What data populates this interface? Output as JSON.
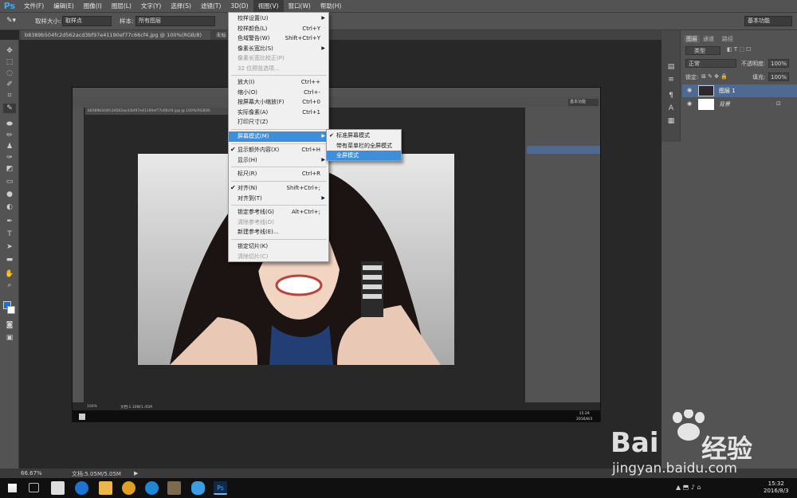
{
  "app": {
    "logo": "Ps"
  },
  "menubar": [
    {
      "label": "文件(F)"
    },
    {
      "label": "编辑(E)"
    },
    {
      "label": "图像(I)"
    },
    {
      "label": "图层(L)"
    },
    {
      "label": "文字(Y)"
    },
    {
      "label": "选择(S)"
    },
    {
      "label": "滤镜(T)"
    },
    {
      "label": "3D(D)"
    },
    {
      "label": "视图(V)"
    },
    {
      "label": "窗口(W)"
    },
    {
      "label": "帮助(H)"
    }
  ],
  "options": {
    "sample_size_label": "取样大小:",
    "sample_size_value": "取样点",
    "sample_label": "样本:",
    "sample_value": "所有图层",
    "workspace": "基本功能"
  },
  "tabs": [
    {
      "label": "b8389b504fc2d562acd3bf97e41190ef77c66cf4.jpg @ 100%(RGB/8)"
    },
    {
      "label": "未标"
    }
  ],
  "view_menu": [
    {
      "label": "校样设置(U)",
      "shortcut": "",
      "submenu": true,
      "disabled": false
    },
    {
      "label": "校样颜色(L)",
      "shortcut": "Ctrl+Y",
      "submenu": false,
      "disabled": false
    },
    {
      "label": "色域警告(W)",
      "shortcut": "Shift+Ctrl+Y",
      "submenu": false,
      "disabled": false
    },
    {
      "label": "像素长宽比(S)",
      "shortcut": "",
      "submenu": true,
      "disabled": false
    },
    {
      "label": "像素长宽比校正(P)",
      "shortcut": "",
      "submenu": false,
      "disabled": true
    },
    {
      "label": "32 位预览选项...",
      "shortcut": "",
      "submenu": false,
      "disabled": true
    },
    {
      "label": "放大(I)",
      "shortcut": "Ctrl++",
      "submenu": false,
      "disabled": false
    },
    {
      "label": "缩小(O)",
      "shortcut": "Ctrl+-",
      "submenu": false,
      "disabled": false
    },
    {
      "label": "按屏幕大小缩放(F)",
      "shortcut": "Ctrl+0",
      "submenu": false,
      "disabled": false
    },
    {
      "label": "实际像素(A)",
      "shortcut": "Ctrl+1",
      "submenu": false,
      "disabled": false
    },
    {
      "label": "打印尺寸(Z)",
      "shortcut": "",
      "submenu": false,
      "disabled": false
    },
    {
      "label": "屏幕模式(M)",
      "shortcut": "",
      "submenu": true,
      "disabled": false
    },
    {
      "label": "显示额外内容(X)",
      "shortcut": "Ctrl+H",
      "submenu": false,
      "disabled": false
    },
    {
      "label": "显示(H)",
      "shortcut": "",
      "submenu": true,
      "disabled": false
    },
    {
      "label": "标尺(R)",
      "shortcut": "Ctrl+R",
      "submenu": false,
      "disabled": false
    },
    {
      "label": "对齐(N)",
      "shortcut": "Shift+Ctrl+;",
      "submenu": false,
      "disabled": false
    },
    {
      "label": "对齐到(T)",
      "shortcut": "",
      "submenu": true,
      "disabled": false
    },
    {
      "label": "锁定参考线(G)",
      "shortcut": "Alt+Ctrl+;",
      "submenu": false,
      "disabled": false
    },
    {
      "label": "清除参考线(D)",
      "shortcut": "",
      "submenu": false,
      "disabled": true
    },
    {
      "label": "新建参考线(E)...",
      "shortcut": "",
      "submenu": false,
      "disabled": false
    },
    {
      "label": "锁定切片(K)",
      "shortcut": "",
      "submenu": false,
      "disabled": false
    },
    {
      "label": "清除切片(C)",
      "shortcut": "",
      "submenu": false,
      "disabled": true
    }
  ],
  "screen_mode_submenu": [
    {
      "label": "标准屏幕模式",
      "checked": true
    },
    {
      "label": "带有菜单栏的全屏模式",
      "checked": false
    },
    {
      "label": "全屏模式",
      "checked": false
    }
  ],
  "panels": {
    "tabs": [
      "图层",
      "通道",
      "路径"
    ],
    "filter": "类型",
    "blend_mode": "正常",
    "opacity_label": "不透明度:",
    "opacity": "100%",
    "lock_label": "锁定:",
    "fill_label": "填充:",
    "fill": "100%",
    "layers": [
      {
        "name": "图层 1",
        "selected": true
      },
      {
        "name": "背景",
        "selected": false
      }
    ]
  },
  "status": {
    "zoom": "66.67%",
    "doc": "文档:5.05M/5.05M"
  },
  "taskbar": {
    "time": "15:32",
    "date": "2016/8/3"
  },
  "nested": {
    "zoom": "100%",
    "doc": "文档:1.10M/1.45M",
    "time": "15:29",
    "date": "2016/8/3",
    "tab": "b8389b504fc2d562acd3bf97e41190ef77c66cf4.jpg @ 100%(RGB/8)",
    "workspace": "基本功能"
  },
  "watermark": {
    "text": "Bai",
    "text2": "经验",
    "url": "jingyan.baidu.com"
  },
  "colors": {
    "accent": "#3c8fdc",
    "ui": "#535353",
    "canvas": "#282828"
  }
}
